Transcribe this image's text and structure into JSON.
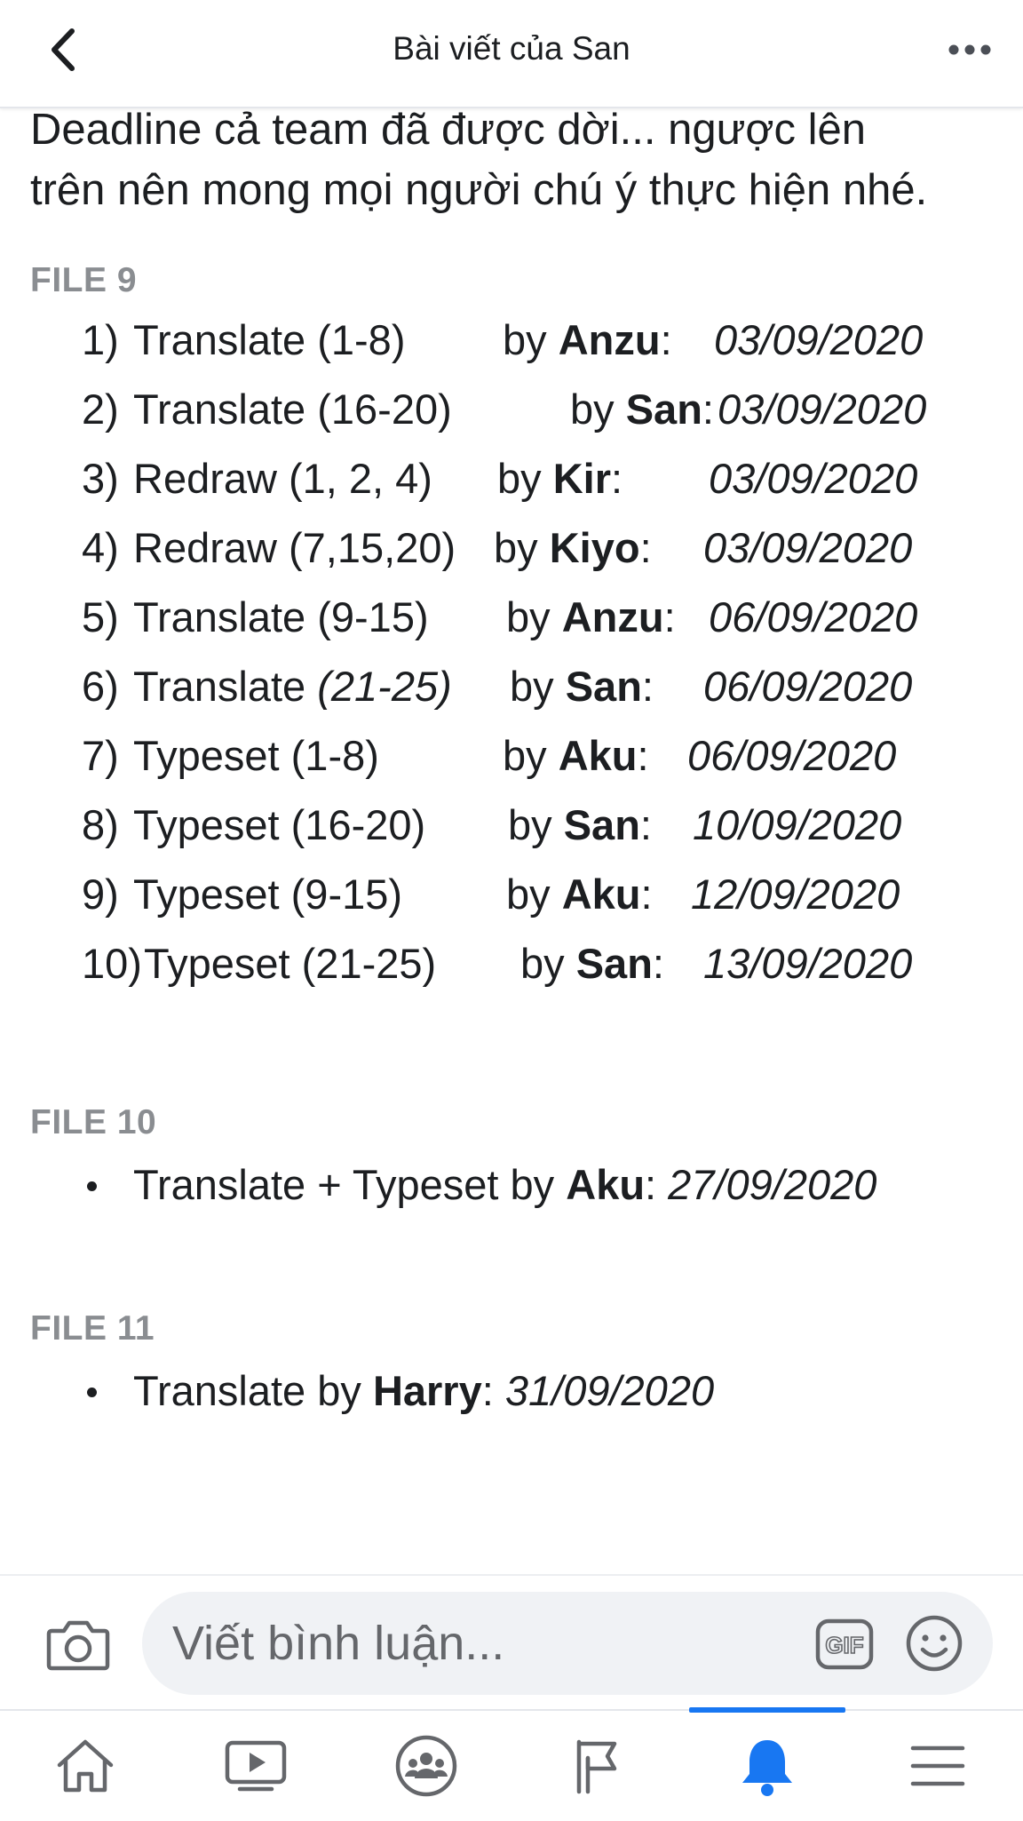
{
  "header": {
    "title": "Bài viết của San"
  },
  "post": {
    "intro": "Deadline cả team đã được dời... ngược lên trên nên mong mọi người chú ý thực hiện nhé.",
    "file9": {
      "heading": "FILE 9",
      "tasks": [
        {
          "num": "1)",
          "task": "Translate (1-8)",
          "by": "by",
          "who": "Anzu",
          "colon": ":",
          "date": "03/09/2020"
        },
        {
          "num": "2)",
          "task": "Translate (16-20)",
          "by": "by",
          "who": "San",
          "colon": ":",
          "date": "03/09/2020"
        },
        {
          "num": "3)",
          "task": "Redraw (1, 2, 4)",
          "by": "by",
          "who": "Kir",
          "colon": ":",
          "date": "03/09/2020"
        },
        {
          "num": "4)",
          "task": "Redraw (7,15,20)",
          "by": "by",
          "who": "Kiyo",
          "colon": ":",
          "date": "03/09/2020"
        },
        {
          "num": "5)",
          "task": "Translate (9-15)",
          "by": "by",
          "who": "Anzu",
          "colon": ":",
          "date": "06/09/2020"
        },
        {
          "num": "6)",
          "task": "Translate ",
          "task_italic": "(21-25)",
          "by": "by",
          "who": "San",
          "colon": ":",
          "date": "06/09/2020"
        },
        {
          "num": "7)",
          "task": "Typeset (1-8)",
          "by": "by",
          "who": "Aku",
          "colon": ":",
          "date": "06/09/2020"
        },
        {
          "num": "8)",
          "task": "Typeset (16-20)",
          "by": "by",
          "who": "San",
          "colon": ":",
          "date": "10/09/2020"
        },
        {
          "num": "9)",
          "task": "Typeset (9-15)",
          "by": "by",
          "who": "Aku",
          "colon": ":",
          "date": "12/09/2020"
        },
        {
          "num": "10)",
          "task": "Typeset (21-25)",
          "by": "by",
          "who": "San",
          "colon": ":",
          "date": "13/09/2020"
        }
      ]
    },
    "file10": {
      "heading": "FILE 10",
      "item": {
        "task": "Translate + Typeset by ",
        "who": "Aku",
        "colon": ": ",
        "date": "27/09/2020"
      }
    },
    "file11": {
      "heading": "FILE 11",
      "item": {
        "task": "Translate by ",
        "who": "Harry",
        "colon": ": ",
        "date": "31/09/2020"
      }
    }
  },
  "comment_bar": {
    "placeholder": "Viết bình luận...",
    "gif_label": "GIF"
  },
  "bottom_nav": {
    "items": [
      "home-icon",
      "watch-icon",
      "groups-icon",
      "pages-flag-icon",
      "notifications-bell-icon",
      "menu-icon"
    ],
    "active": "notifications-bell-icon"
  },
  "colors": {
    "accent": "#1877f2",
    "text": "#1c1e21",
    "muted": "#8a8d91",
    "input_bg": "#f0f2f5"
  }
}
